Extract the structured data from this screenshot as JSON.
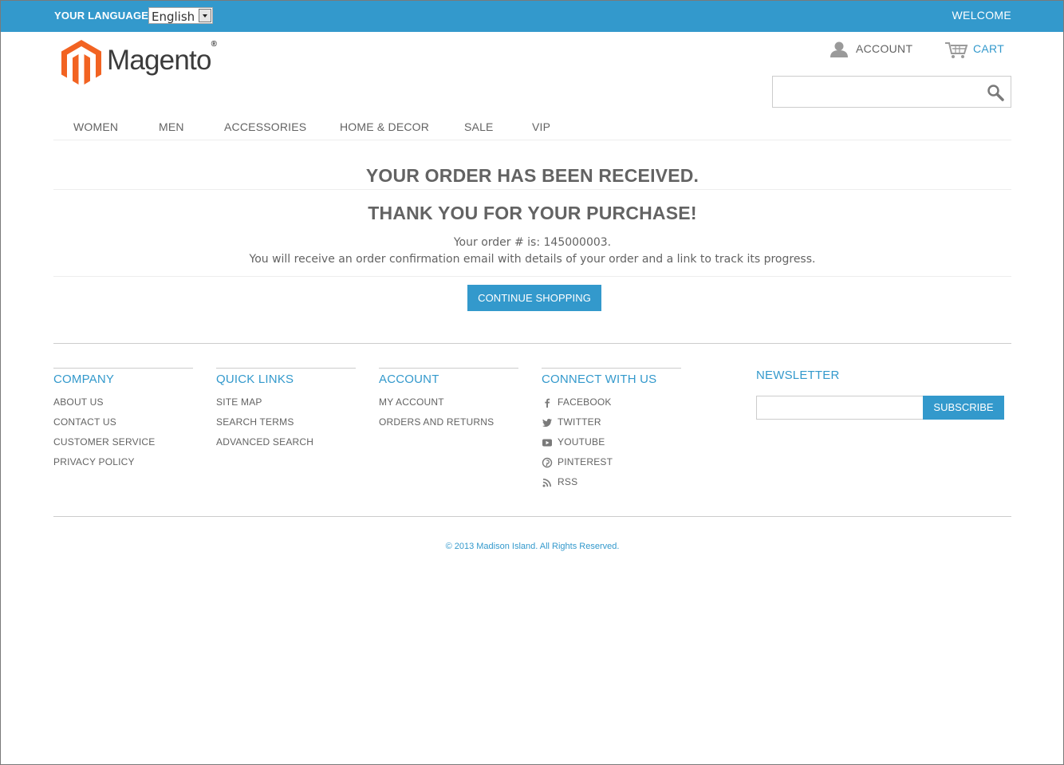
{
  "topbar": {
    "language_label": "YOUR LANGUAGE:",
    "language_value": "English",
    "welcome": "WELCOME",
    "color": "#3399cc"
  },
  "header": {
    "logo_text": "Magento",
    "logo_mark": "®",
    "account_label": "ACCOUNT",
    "cart_label": "CART",
    "search": {
      "value": "",
      "placeholder": ""
    },
    "icons": {
      "account": "user-icon",
      "cart": "cart-icon",
      "search": "search-icon"
    }
  },
  "nav": {
    "items": [
      {
        "label": "WOMEN"
      },
      {
        "label": "MEN"
      },
      {
        "label": "ACCESSORIES"
      },
      {
        "label": "HOME & DECOR"
      },
      {
        "label": "SALE"
      },
      {
        "label": "VIP"
      }
    ]
  },
  "main": {
    "title": "YOUR ORDER HAS BEEN RECEIVED.",
    "subtitle": "THANK YOU FOR YOUR PURCHASE!",
    "order_number_line": "Your order # is: 145000003.",
    "confirmation_line": "You will receive an order confirmation email with details of your order and a link to track its progress.",
    "continue_button": "CONTINUE SHOPPING"
  },
  "footer": {
    "columns": [
      {
        "title": "COMPANY",
        "links": [
          "ABOUT US",
          "CONTACT US",
          "CUSTOMER SERVICE",
          "PRIVACY POLICY"
        ]
      },
      {
        "title": "QUICK LINKS",
        "links": [
          "SITE MAP",
          "SEARCH TERMS",
          "ADVANCED SEARCH"
        ]
      },
      {
        "title": "ACCOUNT",
        "links": [
          "MY ACCOUNT",
          "ORDERS AND RETURNS"
        ]
      },
      {
        "title": "CONNECT WITH US",
        "links": [
          "FACEBOOK",
          "TWITTER",
          "YOUTUBE",
          "PINTEREST",
          "RSS"
        ],
        "icons": [
          "facebook-icon",
          "twitter-icon",
          "youtube-icon",
          "pinterest-icon",
          "rss-icon"
        ]
      }
    ],
    "newsletter": {
      "title": "NEWSLETTER",
      "input_value": "",
      "button": "SUBSCRIBE"
    },
    "copyright": "© 2013 Madison Island. All Rights Reserved."
  },
  "colors": {
    "accent": "#3399cc",
    "text": "#636363",
    "logo_orange": "#f26322"
  }
}
